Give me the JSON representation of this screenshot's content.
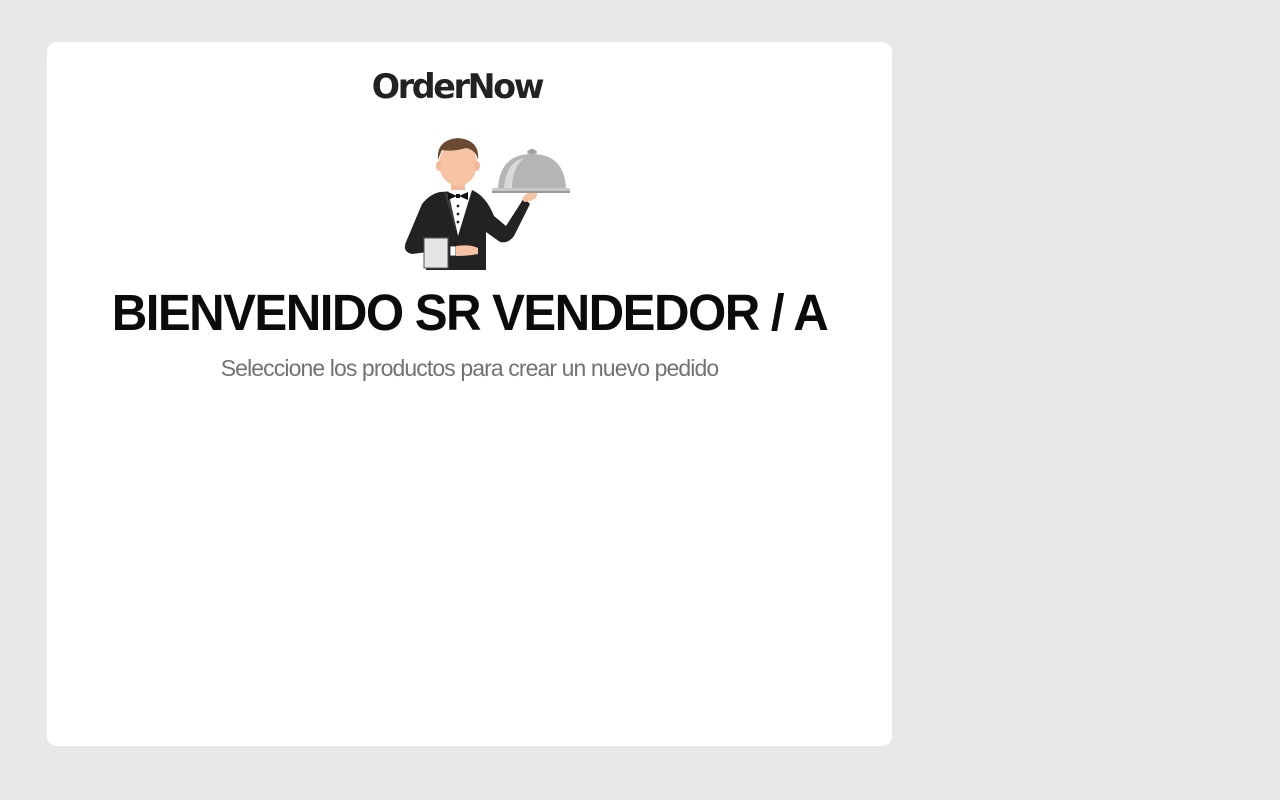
{
  "brand": {
    "name": "OrderNow"
  },
  "welcome": {
    "title": "BIENVENIDO SR VENDEDOR / A",
    "subtitle": "Seleccione los productos para crear un nuevo pedido"
  },
  "illustration": {
    "icon": "waiter-with-cloche-icon"
  },
  "colors": {
    "page_background": "#e9e8e6",
    "card_background": "#ffffff",
    "title_color": "#0b0b0b",
    "subtitle_color": "#757171",
    "logo_color": "#222222"
  }
}
